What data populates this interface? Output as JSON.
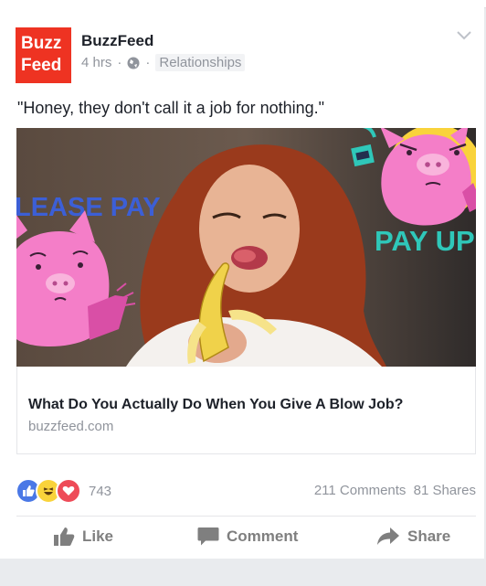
{
  "post": {
    "logo": {
      "line1": "Buzz",
      "line2": "Feed"
    },
    "page_name": "BuzzFeed",
    "time": "4 hrs",
    "separator": "·",
    "category": "Relationships",
    "caption": "\"Honey, they don't call it a job for nothing.\""
  },
  "media": {
    "sticker_left_text": "LEASE PAY",
    "sticker_right_text": "PAY UP"
  },
  "link": {
    "title": "What Do You Actually Do When You Give A Blow Job?",
    "domain": "buzzfeed.com"
  },
  "engagement": {
    "reaction_icons": [
      "like-icon",
      "haha-icon",
      "love-icon"
    ],
    "reaction_count": "743",
    "comments": "211 Comments",
    "shares": "81 Shares"
  },
  "actions": {
    "like": "Like",
    "comment": "Comment",
    "share": "Share"
  },
  "colors": {
    "brand": "#ee3322",
    "like_blue": "#4a78e6",
    "love_red": "#ee4b58",
    "haha_yellow": "#f9d33b",
    "pig_pink": "#f47ec8",
    "sticker_blue": "#3c5fd6",
    "sticker_teal": "#2fc7b9"
  }
}
